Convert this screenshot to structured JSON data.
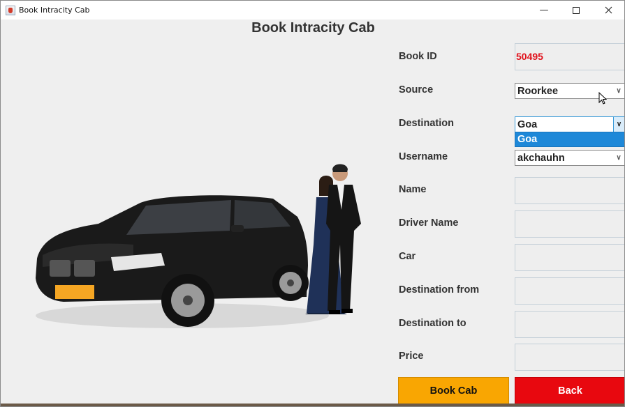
{
  "window": {
    "title": "Book Intracity Cab"
  },
  "heading": "Book Intracity Cab",
  "form": {
    "book_id_label": "Book ID",
    "book_id_value": "50495",
    "source_label": "Source",
    "source_value": "Roorkee",
    "destination_label": "Destination",
    "destination_value": "Goa",
    "destination_options": [
      "Goa"
    ],
    "username_label": "Username",
    "username_value": "akchauhn",
    "name_label": "Name",
    "driver_name_label": "Driver Name",
    "car_label": "Car",
    "destination_from_label": "Destination from",
    "destination_to_label": "Destination to",
    "price_label": "Price"
  },
  "buttons": {
    "book": "Book Cab",
    "back": "Back"
  },
  "colors": {
    "book_button": "#f9a602",
    "back_button": "#e8080f",
    "book_id": "#e0101a",
    "selected_option": "#1e88d8"
  },
  "icons": [
    "java-app-icon",
    "minimize-icon",
    "maximize-icon",
    "close-icon",
    "chevron-down-icon",
    "mouse-cursor-icon"
  ]
}
